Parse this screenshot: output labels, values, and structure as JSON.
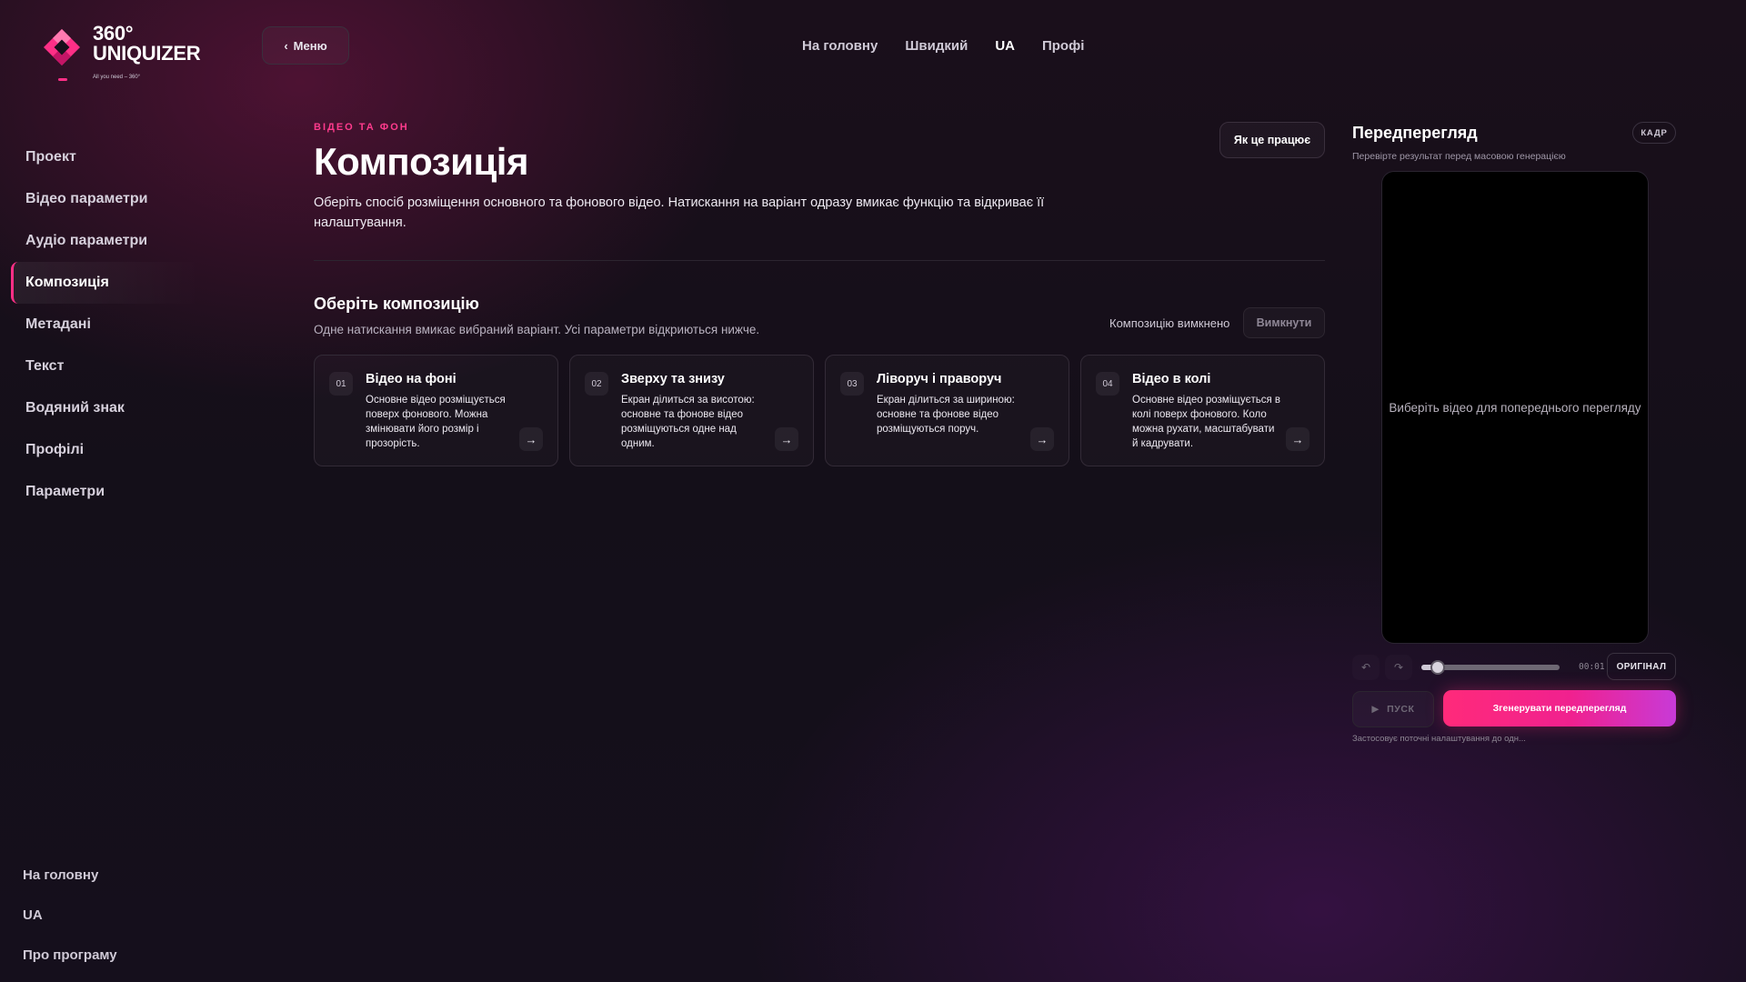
{
  "brand": {
    "name_line1": "360°",
    "name_line2": "UNIQUIZER",
    "tagline": "All you need – 360°",
    "accent": "#ff2f86"
  },
  "header": {
    "menu_label": "Меню",
    "menu_icon": "chevron-left-icon",
    "nav": [
      {
        "label": "На головну",
        "active": false
      },
      {
        "label": "Швидкий",
        "active": false
      },
      {
        "label": "UA",
        "active": true
      },
      {
        "label": "Профі",
        "active": false
      }
    ]
  },
  "sidebar": {
    "items": [
      {
        "label": "Проект",
        "active": false
      },
      {
        "label": "Відео параметри",
        "active": false
      },
      {
        "label": "Аудіо параметри",
        "active": false
      },
      {
        "label": "Композиція",
        "active": true
      },
      {
        "label": "Метадані",
        "active": false
      },
      {
        "label": "Текст",
        "active": false
      },
      {
        "label": "Водяний знак",
        "active": false
      },
      {
        "label": "Профілі",
        "active": false
      },
      {
        "label": "Параметри",
        "active": false
      }
    ],
    "bottom": [
      {
        "label": "На головну"
      },
      {
        "label": "UA"
      },
      {
        "label": "Про програму"
      }
    ]
  },
  "main": {
    "eyebrow": "ВІДЕО ТА ФОН",
    "title": "Композиція",
    "description": "Оберіть спосіб розміщення основного та фонового відео. Натискання на варіант одразу вмикає функцію та відкриває її налаштування.",
    "how_button": "Як це працює",
    "section_title": "Оберіть композицію",
    "section_subtitle": "Одне натискання вмикає вибраний варіант. Усі параметри відкриються нижче.",
    "status_text": "Композицію вимкнено",
    "off_button": "Вимкнути",
    "cards": [
      {
        "num": "01",
        "title": "Відео на фоні",
        "desc": "Основне відео розміщується поверх фонового. Можна змінювати його розмір і прозорість.",
        "arrow": "→"
      },
      {
        "num": "02",
        "title": "Зверху та знизу",
        "desc": "Екран ділиться за висотою: основне та фонове відео розміщуються одне над одним.",
        "arrow": "→"
      },
      {
        "num": "03",
        "title": "Ліворуч і праворуч",
        "desc": "Екран ділиться за шириною: основне та фонове відео розміщуються поруч.",
        "arrow": "→"
      },
      {
        "num": "04",
        "title": "Відео в колі",
        "desc": "Основне відео розміщується в колі поверх фонового. Коло можна рухати, масштабувати й кадрувати.",
        "arrow": "→"
      }
    ]
  },
  "preview": {
    "title": "Передперегляд",
    "subtitle": "Перевірте результат перед масовою генерацією",
    "badge": "КАДР",
    "placeholder": "Виберіть відео для попереднього перегляду",
    "undo_icon": "undo-icon",
    "redo_icon": "redo-icon",
    "progress": 0.12,
    "time": "00:01",
    "original_button": "ОРИГІНАЛ",
    "play_label": "ПУСК",
    "play_icon": "play-icon",
    "generate_button": "Згенерувати передперегляд",
    "note": "Застосовує поточні налаштування до одн..."
  }
}
